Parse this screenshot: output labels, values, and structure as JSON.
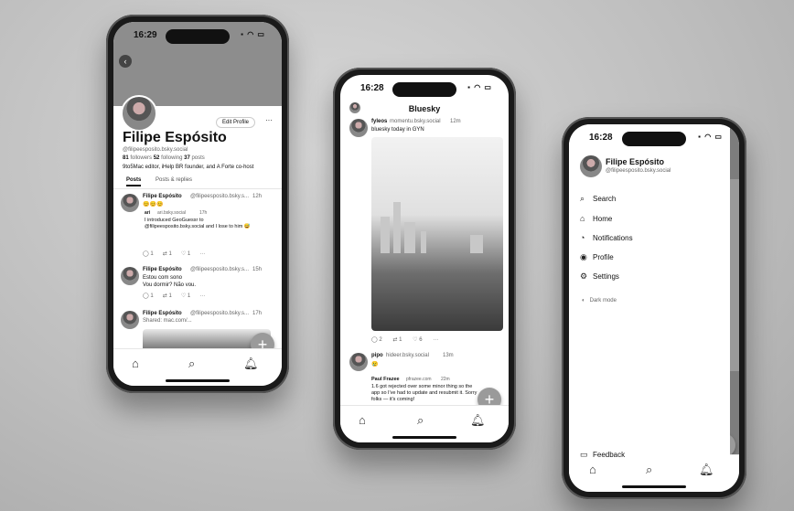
{
  "phone1": {
    "time": "16:29",
    "edit_profile": "Edit Profile",
    "more": "···",
    "name": "Filipe Espósito",
    "handle": "@filipeesposito.bsky.social",
    "followers_count": "81",
    "followers_label": "followers",
    "following_count": "52",
    "following_label": "following",
    "posts_count": "37",
    "posts_label": "posts",
    "bio": "9to5Mac editor, iHelp BR founder, and A Forte co-host",
    "tabs": [
      "Posts",
      "Posts & replies"
    ],
    "posts": [
      {
        "author": "Filipe Espósito",
        "handle": "@filipeesposito.bsky.s...",
        "time": "12h",
        "text": "😊😊😊",
        "quote_author": "ari",
        "quote_handle": "ari.bsky.social",
        "quote_time": "17h",
        "quote_text": "I introduced GeoGuessr to @filipeesposito.bsky.social and I lose to him 😅",
        "replies": "1",
        "reposts": "1",
        "likes": "1"
      },
      {
        "author": "Filipe Espósito",
        "handle": "@filipeesposito.bsky.s...",
        "time": "15h",
        "text": "Estou com sono\nVou dormir? Não vou.",
        "replies": "1",
        "reposts": "1",
        "likes": "1"
      },
      {
        "author": "Filipe Espósito",
        "handle": "@filipeesposito.bsky.s...",
        "time": "17h",
        "text": "Shared: mac.com/...",
        "replies": "",
        "reposts": "",
        "likes": ""
      }
    ]
  },
  "phone2": {
    "time": "16:28",
    "title": "Bluesky",
    "post1": {
      "author": "fyleos",
      "handle": "momentu.bsky.social",
      "time": "12m",
      "text": "bluesky today in GYN",
      "replies": "2",
      "reposts": "1",
      "likes": "6"
    },
    "post2": {
      "author": "pipo",
      "handle": "hideer.bsky.social",
      "time": "13m",
      "text": "😢",
      "quote_author": "Paul Frazee",
      "quote_handle": "pfrazee.com",
      "quote_time": "22m",
      "quote_text": "1.6 got rejected over some minor thing so the app so I've had to update and resubmit it. Sorry folks — it's coming!"
    }
  },
  "phone3": {
    "time": "16:28",
    "name": "Filipe Espósito",
    "handle": "@filipeesposito.bsky.social",
    "menu": [
      "Search",
      "Home",
      "Notifications",
      "Profile",
      "Settings"
    ],
    "dark_mode": "Dark mode",
    "feedback": "Feedback"
  },
  "icons": {
    "home": "home-icon",
    "search": "search-icon",
    "bell": "bell-icon",
    "plus": "plus-icon"
  }
}
